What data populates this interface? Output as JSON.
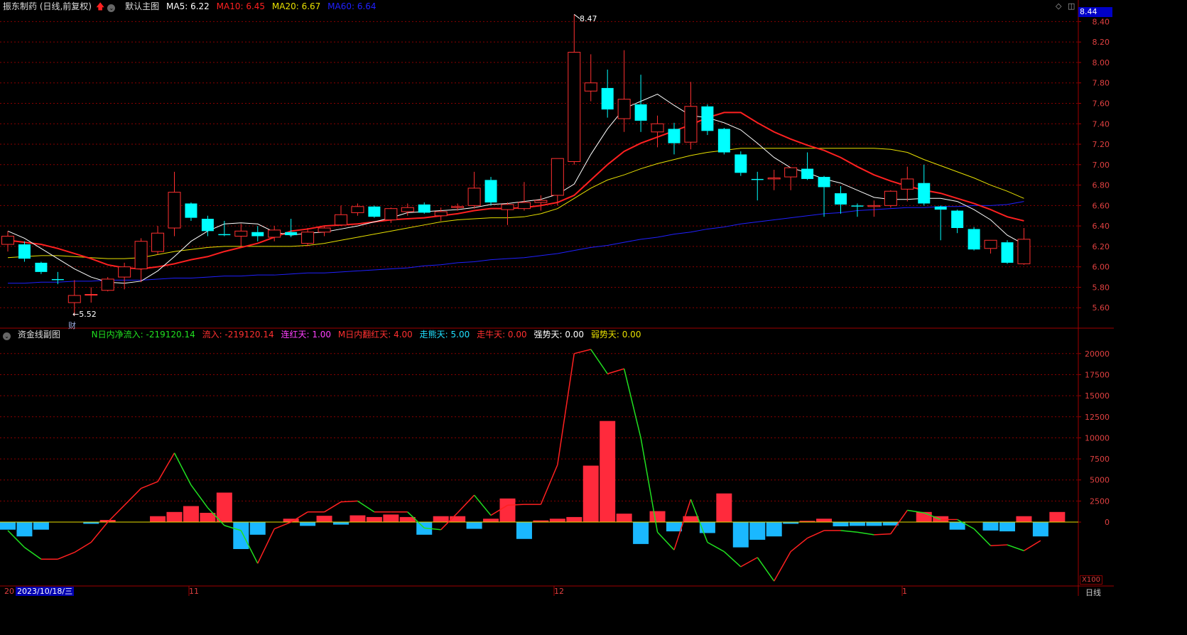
{
  "header": {
    "stock_name": "振东制药 (日线,前复权)",
    "main_chart_label": "默认主图",
    "ma_items": [
      {
        "label": "MA5: 6.22",
        "color": "#ffffff"
      },
      {
        "label": "MA10: 6.45",
        "color": "#ff2020"
      },
      {
        "label": "MA20: 6.67",
        "color": "#e8e000"
      },
      {
        "label": "MA60: 6.64",
        "color": "#2020ff"
      }
    ]
  },
  "sub_header": {
    "title": "资金线副图",
    "items": [
      {
        "label": "N日内净流入: -219120.14",
        "color": "#20e020"
      },
      {
        "label": "流入: -219120.14",
        "color": "#ff3030"
      },
      {
        "label": "连红天: 1.00",
        "color": "#ff40ff"
      },
      {
        "label": "M日内翻红天: 4.00",
        "color": "#ff3030"
      },
      {
        "label": "走熊天: 5.00",
        "color": "#20e0ff"
      },
      {
        "label": "走牛天: 0.00",
        "color": "#ff3030"
      },
      {
        "label": "强势天: 0.00",
        "color": "#ffffff"
      },
      {
        "label": "弱势天: 0.00",
        "color": "#e8e000"
      }
    ]
  },
  "current_price": "8.44",
  "high_annotation": "8.47",
  "low_annotation": "←5.52",
  "fin_marker": "财",
  "cursor_date": "2023/10/18/三",
  "period_label": "日线",
  "unit_label": "X100",
  "x_axis_labels": [
    "20",
    "11",
    "12",
    "1"
  ],
  "colors": {
    "up": "#ff3030",
    "down": "#00ffff",
    "ma5": "#ffffff",
    "ma10": "#ff2020",
    "ma20": "#e8e000",
    "ma60": "#2020ff",
    "flow_line": "#20e020",
    "grid": "#8a0000"
  },
  "chart_data": [
    {
      "type": "candlestick",
      "title": "振东制药 (日线,前复权)",
      "y_ticks": [
        5.6,
        5.8,
        6.0,
        6.2,
        6.4,
        6.6,
        6.8,
        7.0,
        7.2,
        7.4,
        7.6,
        7.8,
        8.0,
        8.2,
        8.4
      ],
      "ylim": [
        5.4,
        8.5
      ],
      "candles": [
        {
          "o": 6.22,
          "h": 6.35,
          "l": 6.15,
          "c": 6.3
        },
        {
          "o": 6.22,
          "h": 6.25,
          "l": 6.05,
          "c": 6.08
        },
        {
          "o": 6.04,
          "h": 6.05,
          "l": 5.93,
          "c": 5.95
        },
        {
          "o": 5.88,
          "h": 5.95,
          "l": 5.83,
          "c": 5.87
        },
        {
          "o": 5.65,
          "h": 5.87,
          "l": 5.52,
          "c": 5.72
        },
        {
          "o": 5.73,
          "h": 5.8,
          "l": 5.65,
          "c": 5.73
        },
        {
          "o": 5.77,
          "h": 5.9,
          "l": 5.76,
          "c": 5.88
        },
        {
          "o": 5.9,
          "h": 6.04,
          "l": 5.78,
          "c": 6.0
        },
        {
          "o": 5.98,
          "h": 6.28,
          "l": 5.85,
          "c": 6.25
        },
        {
          "o": 6.15,
          "h": 6.4,
          "l": 6.12,
          "c": 6.33
        },
        {
          "o": 6.38,
          "h": 6.93,
          "l": 6.3,
          "c": 6.73
        },
        {
          "o": 6.62,
          "h": 6.63,
          "l": 6.45,
          "c": 6.48
        },
        {
          "o": 6.47,
          "h": 6.5,
          "l": 6.3,
          "c": 6.35
        },
        {
          "o": 6.32,
          "h": 6.45,
          "l": 6.3,
          "c": 6.31
        },
        {
          "o": 6.3,
          "h": 6.42,
          "l": 6.2,
          "c": 6.35
        },
        {
          "o": 6.34,
          "h": 6.4,
          "l": 6.25,
          "c": 6.3
        },
        {
          "o": 6.29,
          "h": 6.4,
          "l": 6.25,
          "c": 6.36
        },
        {
          "o": 6.34,
          "h": 6.47,
          "l": 6.29,
          "c": 6.31
        },
        {
          "o": 6.23,
          "h": 6.38,
          "l": 6.2,
          "c": 6.34
        },
        {
          "o": 6.34,
          "h": 6.4,
          "l": 6.3,
          "c": 6.38
        },
        {
          "o": 6.41,
          "h": 6.6,
          "l": 6.4,
          "c": 6.51
        },
        {
          "o": 6.53,
          "h": 6.62,
          "l": 6.5,
          "c": 6.59
        },
        {
          "o": 6.59,
          "h": 6.6,
          "l": 6.48,
          "c": 6.49
        },
        {
          "o": 6.46,
          "h": 6.58,
          "l": 6.43,
          "c": 6.57
        },
        {
          "o": 6.54,
          "h": 6.62,
          "l": 6.5,
          "c": 6.58
        },
        {
          "o": 6.61,
          "h": 6.63,
          "l": 6.52,
          "c": 6.53
        },
        {
          "o": 6.5,
          "h": 6.58,
          "l": 6.45,
          "c": 6.54
        },
        {
          "o": 6.58,
          "h": 6.62,
          "l": 6.55,
          "c": 6.59
        },
        {
          "o": 6.6,
          "h": 6.93,
          "l": 6.57,
          "c": 6.77
        },
        {
          "o": 6.85,
          "h": 6.88,
          "l": 6.6,
          "c": 6.63
        },
        {
          "o": 6.56,
          "h": 6.63,
          "l": 6.41,
          "c": 6.61
        },
        {
          "o": 6.57,
          "h": 6.83,
          "l": 6.55,
          "c": 6.63
        },
        {
          "o": 6.63,
          "h": 6.7,
          "l": 6.55,
          "c": 6.65
        },
        {
          "o": 6.7,
          "h": 7.06,
          "l": 6.6,
          "c": 7.06
        },
        {
          "o": 7.03,
          "h": 8.47,
          "l": 7.0,
          "c": 8.1
        },
        {
          "o": 7.72,
          "h": 8.08,
          "l": 7.62,
          "c": 7.8
        },
        {
          "o": 7.75,
          "h": 7.93,
          "l": 7.46,
          "c": 7.54
        },
        {
          "o": 7.45,
          "h": 8.12,
          "l": 7.32,
          "c": 7.64
        },
        {
          "o": 7.59,
          "h": 7.88,
          "l": 7.32,
          "c": 7.43
        },
        {
          "o": 7.32,
          "h": 7.48,
          "l": 7.17,
          "c": 7.4
        },
        {
          "o": 7.35,
          "h": 7.41,
          "l": 7.1,
          "c": 7.21
        },
        {
          "o": 7.22,
          "h": 7.81,
          "l": 7.15,
          "c": 7.57
        },
        {
          "o": 7.57,
          "h": 7.59,
          "l": 7.29,
          "c": 7.33
        },
        {
          "o": 7.35,
          "h": 7.36,
          "l": 7.1,
          "c": 7.12
        },
        {
          "o": 7.1,
          "h": 7.13,
          "l": 6.89,
          "c": 6.92
        },
        {
          "o": 6.86,
          "h": 6.93,
          "l": 6.65,
          "c": 6.85
        },
        {
          "o": 6.86,
          "h": 6.95,
          "l": 6.75,
          "c": 6.87
        },
        {
          "o": 6.88,
          "h": 6.97,
          "l": 6.75,
          "c": 6.97
        },
        {
          "o": 6.96,
          "h": 7.12,
          "l": 6.85,
          "c": 6.86
        },
        {
          "o": 6.88,
          "h": 6.89,
          "l": 6.49,
          "c": 6.78
        },
        {
          "o": 6.72,
          "h": 6.79,
          "l": 6.52,
          "c": 6.61
        },
        {
          "o": 6.6,
          "h": 6.62,
          "l": 6.49,
          "c": 6.59
        },
        {
          "o": 6.59,
          "h": 6.65,
          "l": 6.49,
          "c": 6.6
        },
        {
          "o": 6.6,
          "h": 6.75,
          "l": 6.58,
          "c": 6.74
        },
        {
          "o": 6.76,
          "h": 6.98,
          "l": 6.64,
          "c": 6.86
        },
        {
          "o": 6.82,
          "h": 7.0,
          "l": 6.6,
          "c": 6.62
        },
        {
          "o": 6.59,
          "h": 6.6,
          "l": 6.26,
          "c": 6.56
        },
        {
          "o": 6.55,
          "h": 6.56,
          "l": 6.33,
          "c": 6.38
        },
        {
          "o": 6.37,
          "h": 6.39,
          "l": 6.16,
          "c": 6.17
        },
        {
          "o": 6.18,
          "h": 6.26,
          "l": 6.13,
          "c": 6.26
        },
        {
          "o": 6.24,
          "h": 6.26,
          "l": 6.03,
          "c": 6.04
        },
        {
          "o": 6.03,
          "h": 6.38,
          "l": 6.02,
          "c": 6.27
        }
      ],
      "series": [
        {
          "name": "MA5",
          "values": [
            6.35,
            6.28,
            6.18,
            6.08,
            5.98,
            5.9,
            5.85,
            5.84,
            5.86,
            5.96,
            6.1,
            6.25,
            6.35,
            6.42,
            6.43,
            6.42,
            6.34,
            6.31,
            6.33,
            6.34,
            6.37,
            6.4,
            6.44,
            6.48,
            6.53,
            6.54,
            6.55,
            6.56,
            6.58,
            6.61,
            6.62,
            6.64,
            6.66,
            6.71,
            6.81,
            7.1,
            7.35,
            7.55,
            7.62,
            7.69,
            7.58,
            7.48,
            7.46,
            7.41,
            7.34,
            7.21,
            7.07,
            6.97,
            6.92,
            6.86,
            6.82,
            6.75,
            6.68,
            6.66,
            6.66,
            6.67,
            6.67,
            6.64,
            6.56,
            6.46,
            6.31,
            6.22
          ]
        },
        {
          "name": "MA10",
          "values": [
            6.26,
            6.24,
            6.22,
            6.18,
            6.13,
            6.08,
            6.02,
            5.99,
            5.98,
            6.0,
            6.03,
            6.07,
            6.1,
            6.15,
            6.19,
            6.23,
            6.29,
            6.35,
            6.37,
            6.4,
            6.41,
            6.42,
            6.44,
            6.46,
            6.47,
            6.48,
            6.5,
            6.52,
            6.55,
            6.57,
            6.57,
            6.58,
            6.6,
            6.63,
            6.7,
            6.85,
            7.0,
            7.13,
            7.21,
            7.27,
            7.33,
            7.39,
            7.46,
            7.51,
            7.51,
            7.41,
            7.32,
            7.25,
            7.19,
            7.14,
            7.07,
            6.98,
            6.9,
            6.84,
            6.79,
            6.75,
            6.72,
            6.67,
            6.62,
            6.56,
            6.49,
            6.45
          ]
        },
        {
          "name": "MA20",
          "values": [
            6.09,
            6.1,
            6.11,
            6.11,
            6.1,
            6.09,
            6.08,
            6.08,
            6.09,
            6.12,
            6.15,
            6.17,
            6.19,
            6.2,
            6.2,
            6.2,
            6.2,
            6.2,
            6.21,
            6.23,
            6.26,
            6.29,
            6.32,
            6.35,
            6.38,
            6.41,
            6.44,
            6.46,
            6.47,
            6.48,
            6.48,
            6.49,
            6.52,
            6.57,
            6.67,
            6.77,
            6.85,
            6.9,
            6.96,
            7.01,
            7.05,
            7.09,
            7.12,
            7.14,
            7.16,
            7.16,
            7.16,
            7.16,
            7.16,
            7.16,
            7.16,
            7.16,
            7.16,
            7.15,
            7.12,
            7.05,
            6.99,
            6.93,
            6.87,
            6.8,
            6.74,
            6.67
          ]
        },
        {
          "name": "MA60",
          "values": [
            5.84,
            5.84,
            5.85,
            5.85,
            5.86,
            5.86,
            5.87,
            5.87,
            5.87,
            5.88,
            5.89,
            5.89,
            5.9,
            5.91,
            5.91,
            5.92,
            5.92,
            5.93,
            5.94,
            5.94,
            5.95,
            5.96,
            5.97,
            5.98,
            5.99,
            6.01,
            6.02,
            6.04,
            6.05,
            6.07,
            6.08,
            6.09,
            6.11,
            6.13,
            6.16,
            6.19,
            6.21,
            6.24,
            6.27,
            6.29,
            6.32,
            6.34,
            6.37,
            6.39,
            6.42,
            6.44,
            6.46,
            6.48,
            6.5,
            6.52,
            6.53,
            6.55,
            6.56,
            6.57,
            6.58,
            6.58,
            6.59,
            6.59,
            6.6,
            6.6,
            6.61,
            6.64
          ]
        }
      ]
    },
    {
      "type": "bar",
      "title": "资金线副图",
      "y_ticks": [
        0,
        2500,
        5000,
        7500,
        10000,
        12500,
        15000,
        17500,
        20000
      ],
      "ylim": [
        -7500,
        21500
      ],
      "values": [
        -900,
        -1700,
        -900,
        0,
        0,
        -200,
        250,
        0,
        0,
        700,
        1200,
        1900,
        1100,
        3500,
        -3200,
        -1500,
        0,
        400,
        -450,
        750,
        -300,
        800,
        600,
        900,
        600,
        -1500,
        700,
        700,
        -800,
        400,
        2800,
        -2000,
        200,
        400,
        600,
        6700,
        12000,
        1000,
        -2600,
        1300,
        -1100,
        700,
        -1300,
        3400,
        -3000,
        -2100,
        -1700,
        -200,
        150,
        400,
        -500,
        -450,
        -450,
        -400,
        0,
        1200,
        700,
        -900,
        0,
        -1000,
        -1100,
        700,
        -1700,
        1200
      ],
      "line": [
        -1000,
        -3000,
        -4400,
        -4400,
        -3600,
        -2400,
        0,
        2000,
        4000,
        4800,
        8200,
        4400,
        1700,
        -400,
        -1000,
        -4900,
        -800,
        0,
        1200,
        1200,
        2400,
        2500,
        1200,
        1200,
        1200,
        -700,
        -900,
        1100,
        3200,
        800,
        2000,
        2100,
        2100,
        6800,
        20000,
        20500,
        17600,
        18200,
        10000,
        -1200,
        -3300,
        2700,
        -2400,
        -3500,
        -5300,
        -4200,
        -7000,
        -3500,
        -1900,
        -1000,
        -1000,
        -1200,
        -1500,
        -1400,
        1400,
        1100,
        300,
        300,
        -800,
        -2800,
        -2700,
        -3400,
        -2200
      ]
    }
  ]
}
